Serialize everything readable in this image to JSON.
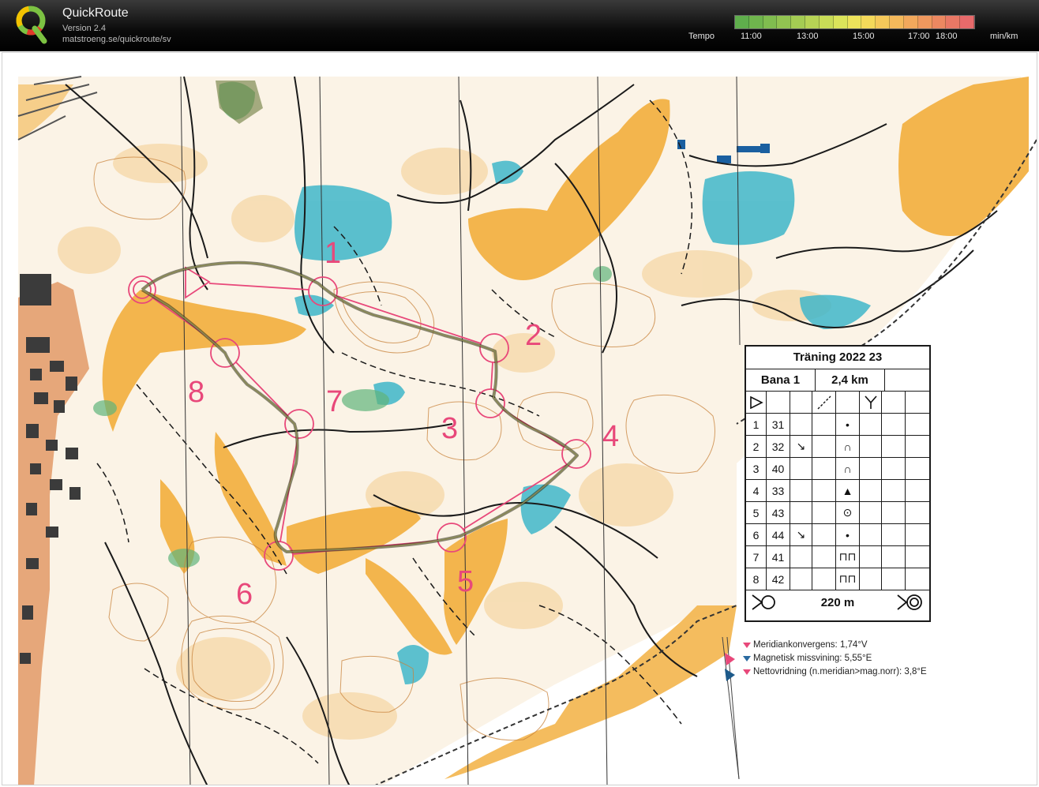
{
  "header": {
    "app_name": "QuickRoute",
    "version": "Version 2.4",
    "url": "matstroeng.se/quickroute/sv",
    "tempo_label": "Tempo",
    "tempo_ticks": [
      "11:00",
      "13:00",
      "15:00",
      "17:00",
      "18:00"
    ],
    "tempo_unit": "min/km",
    "tempo_colors": [
      "#5fae4c",
      "#6fb54d",
      "#80bd4f",
      "#92c451",
      "#a4cc53",
      "#b7d455",
      "#c9dc57",
      "#dbe45a",
      "#ede35b",
      "#f4d95a",
      "#f5c95a",
      "#f4b95b",
      "#f2a85c",
      "#ef985e",
      "#ec8861",
      "#e97865",
      "#e76a6b"
    ]
  },
  "map": {
    "control_numbers": [
      "1",
      "2",
      "3",
      "4",
      "5",
      "6",
      "7",
      "8"
    ],
    "course_color": "#e8487a",
    "route_color": "#5a5a3a"
  },
  "legend": {
    "title": "Träning 2022 23",
    "course_name": "Bana 1",
    "course_length": "2,4 km",
    "controls": [
      {
        "num": "1",
        "code": "31",
        "dir": "",
        "symbol": "•"
      },
      {
        "num": "2",
        "code": "32",
        "dir": "↘",
        "symbol": "∩"
      },
      {
        "num": "3",
        "code": "40",
        "dir": "",
        "symbol": "∩"
      },
      {
        "num": "4",
        "code": "33",
        "dir": "",
        "symbol": "▲"
      },
      {
        "num": "5",
        "code": "43",
        "dir": "",
        "symbol": "⊙"
      },
      {
        "num": "6",
        "code": "44",
        "dir": "↘",
        "symbol": "•"
      },
      {
        "num": "7",
        "code": "41",
        "dir": "",
        "symbol": "⊓⊓"
      },
      {
        "num": "8",
        "code": "42",
        "dir": "",
        "symbol": "⊓⊓"
      }
    ],
    "finish_distance": "220 m"
  },
  "declination": {
    "lines": [
      {
        "text": "Meridiankonvergens: 1,74°V",
        "color": "#e8487a"
      },
      {
        "text": "Magnetisk missvining: 5,55°E",
        "color": "#2a6aa0"
      },
      {
        "text": "Nettovridning (n.meridian>mag.norr): 3,8°E",
        "color": "#e8487a"
      }
    ]
  }
}
